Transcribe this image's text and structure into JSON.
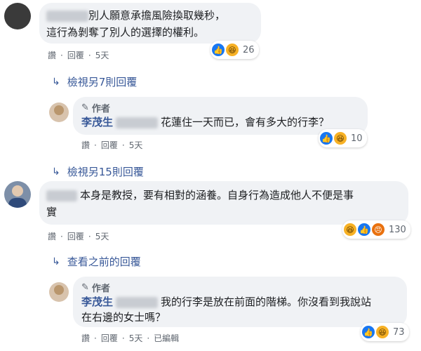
{
  "c1": {
    "text_line1": "別人願意承擔風險換取幾秒，",
    "text_line2": "這行為剝奪了別人的選擇的權利。",
    "actions": {
      "read": "讚",
      "reply": "回覆",
      "time": "5天"
    },
    "reaction_count": "26"
  },
  "more1": "檢視另7則回覆",
  "r1": {
    "author_tag": "作者",
    "name": "李茂生",
    "text": "花蓮住一天而已，會有多大的行李？",
    "actions": {
      "read": "讚",
      "reply": "回覆",
      "time": "5天"
    },
    "reaction_count": "10"
  },
  "more2": "檢視另15則回覆",
  "c2": {
    "text_line1": "本身是教授，要有相對的涵養。自身行為造成他人不便是事",
    "text_line2": "實",
    "actions": {
      "read": "讚",
      "reply": "回覆",
      "time": "5天"
    },
    "reaction_count": "130"
  },
  "more3": "查看之前的回覆",
  "r2": {
    "author_tag": "作者",
    "name": "李茂生",
    "text_line1": "我的行李是放在前面的階梯。你沒看到我說站",
    "text_line2": "在右邊的女士嗎？",
    "actions": {
      "read": "讚",
      "reply": "回覆",
      "time": "5天",
      "edited": "已編輯"
    },
    "reaction_count": "73"
  },
  "colors": {
    "link": "#385898",
    "bubble": "#f0f2f5",
    "like": "#1877f2",
    "haha": "#f7b125",
    "angry": "#e9710f"
  }
}
